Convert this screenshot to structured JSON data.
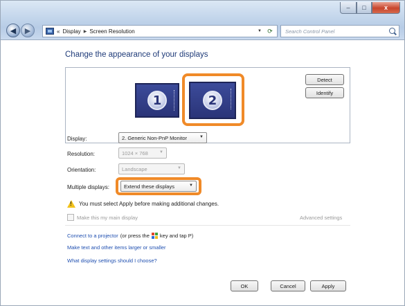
{
  "window": {
    "controls": {
      "minimize": "–",
      "maximize": "□",
      "close": "x"
    }
  },
  "nav": {
    "back_glyph": "◀",
    "forward_glyph": "▶",
    "breadcrumb": [
      "«",
      "Display",
      "Screen Resolution"
    ],
    "search_placeholder": "Search Control Panel"
  },
  "page": {
    "heading": "Change the appearance of your displays"
  },
  "preview": {
    "monitors": [
      {
        "number": "1",
        "selected": false
      },
      {
        "number": "2",
        "selected": true
      }
    ],
    "detect_label": "Detect",
    "identify_label": "Identify"
  },
  "settings": {
    "display": {
      "label": "Display:",
      "value": "2. Generic Non-PnP Monitor"
    },
    "resolution": {
      "label": "Resolution:",
      "value": "1024 × 768"
    },
    "orientation": {
      "label": "Orientation:",
      "value": "Landscape"
    },
    "multiple": {
      "label": "Multiple displays:",
      "value": "Extend these displays"
    }
  },
  "warning": {
    "text": "You must select Apply before making additional changes."
  },
  "main_display": {
    "label": "Make this my main display",
    "checked": false
  },
  "advanced_link": "Advanced settings",
  "links": {
    "projector_link": "Connect to a projector",
    "projector_rest_before": "(or press the",
    "projector_rest_after": "key and tap P)",
    "text_size": "Make text and other items larger or smaller",
    "which_settings": "What display settings should I choose?"
  },
  "footer": {
    "ok": "OK",
    "cancel": "Cancel",
    "apply": "Apply"
  },
  "colors": {
    "highlight": "#f08a28",
    "link": "#1f4fb0",
    "heading": "#1e3a78"
  },
  "icons": [
    "back-icon",
    "forward-icon",
    "control-panel-icon",
    "refresh-icon",
    "search-icon",
    "warning-icon",
    "windows-key-icon"
  ]
}
